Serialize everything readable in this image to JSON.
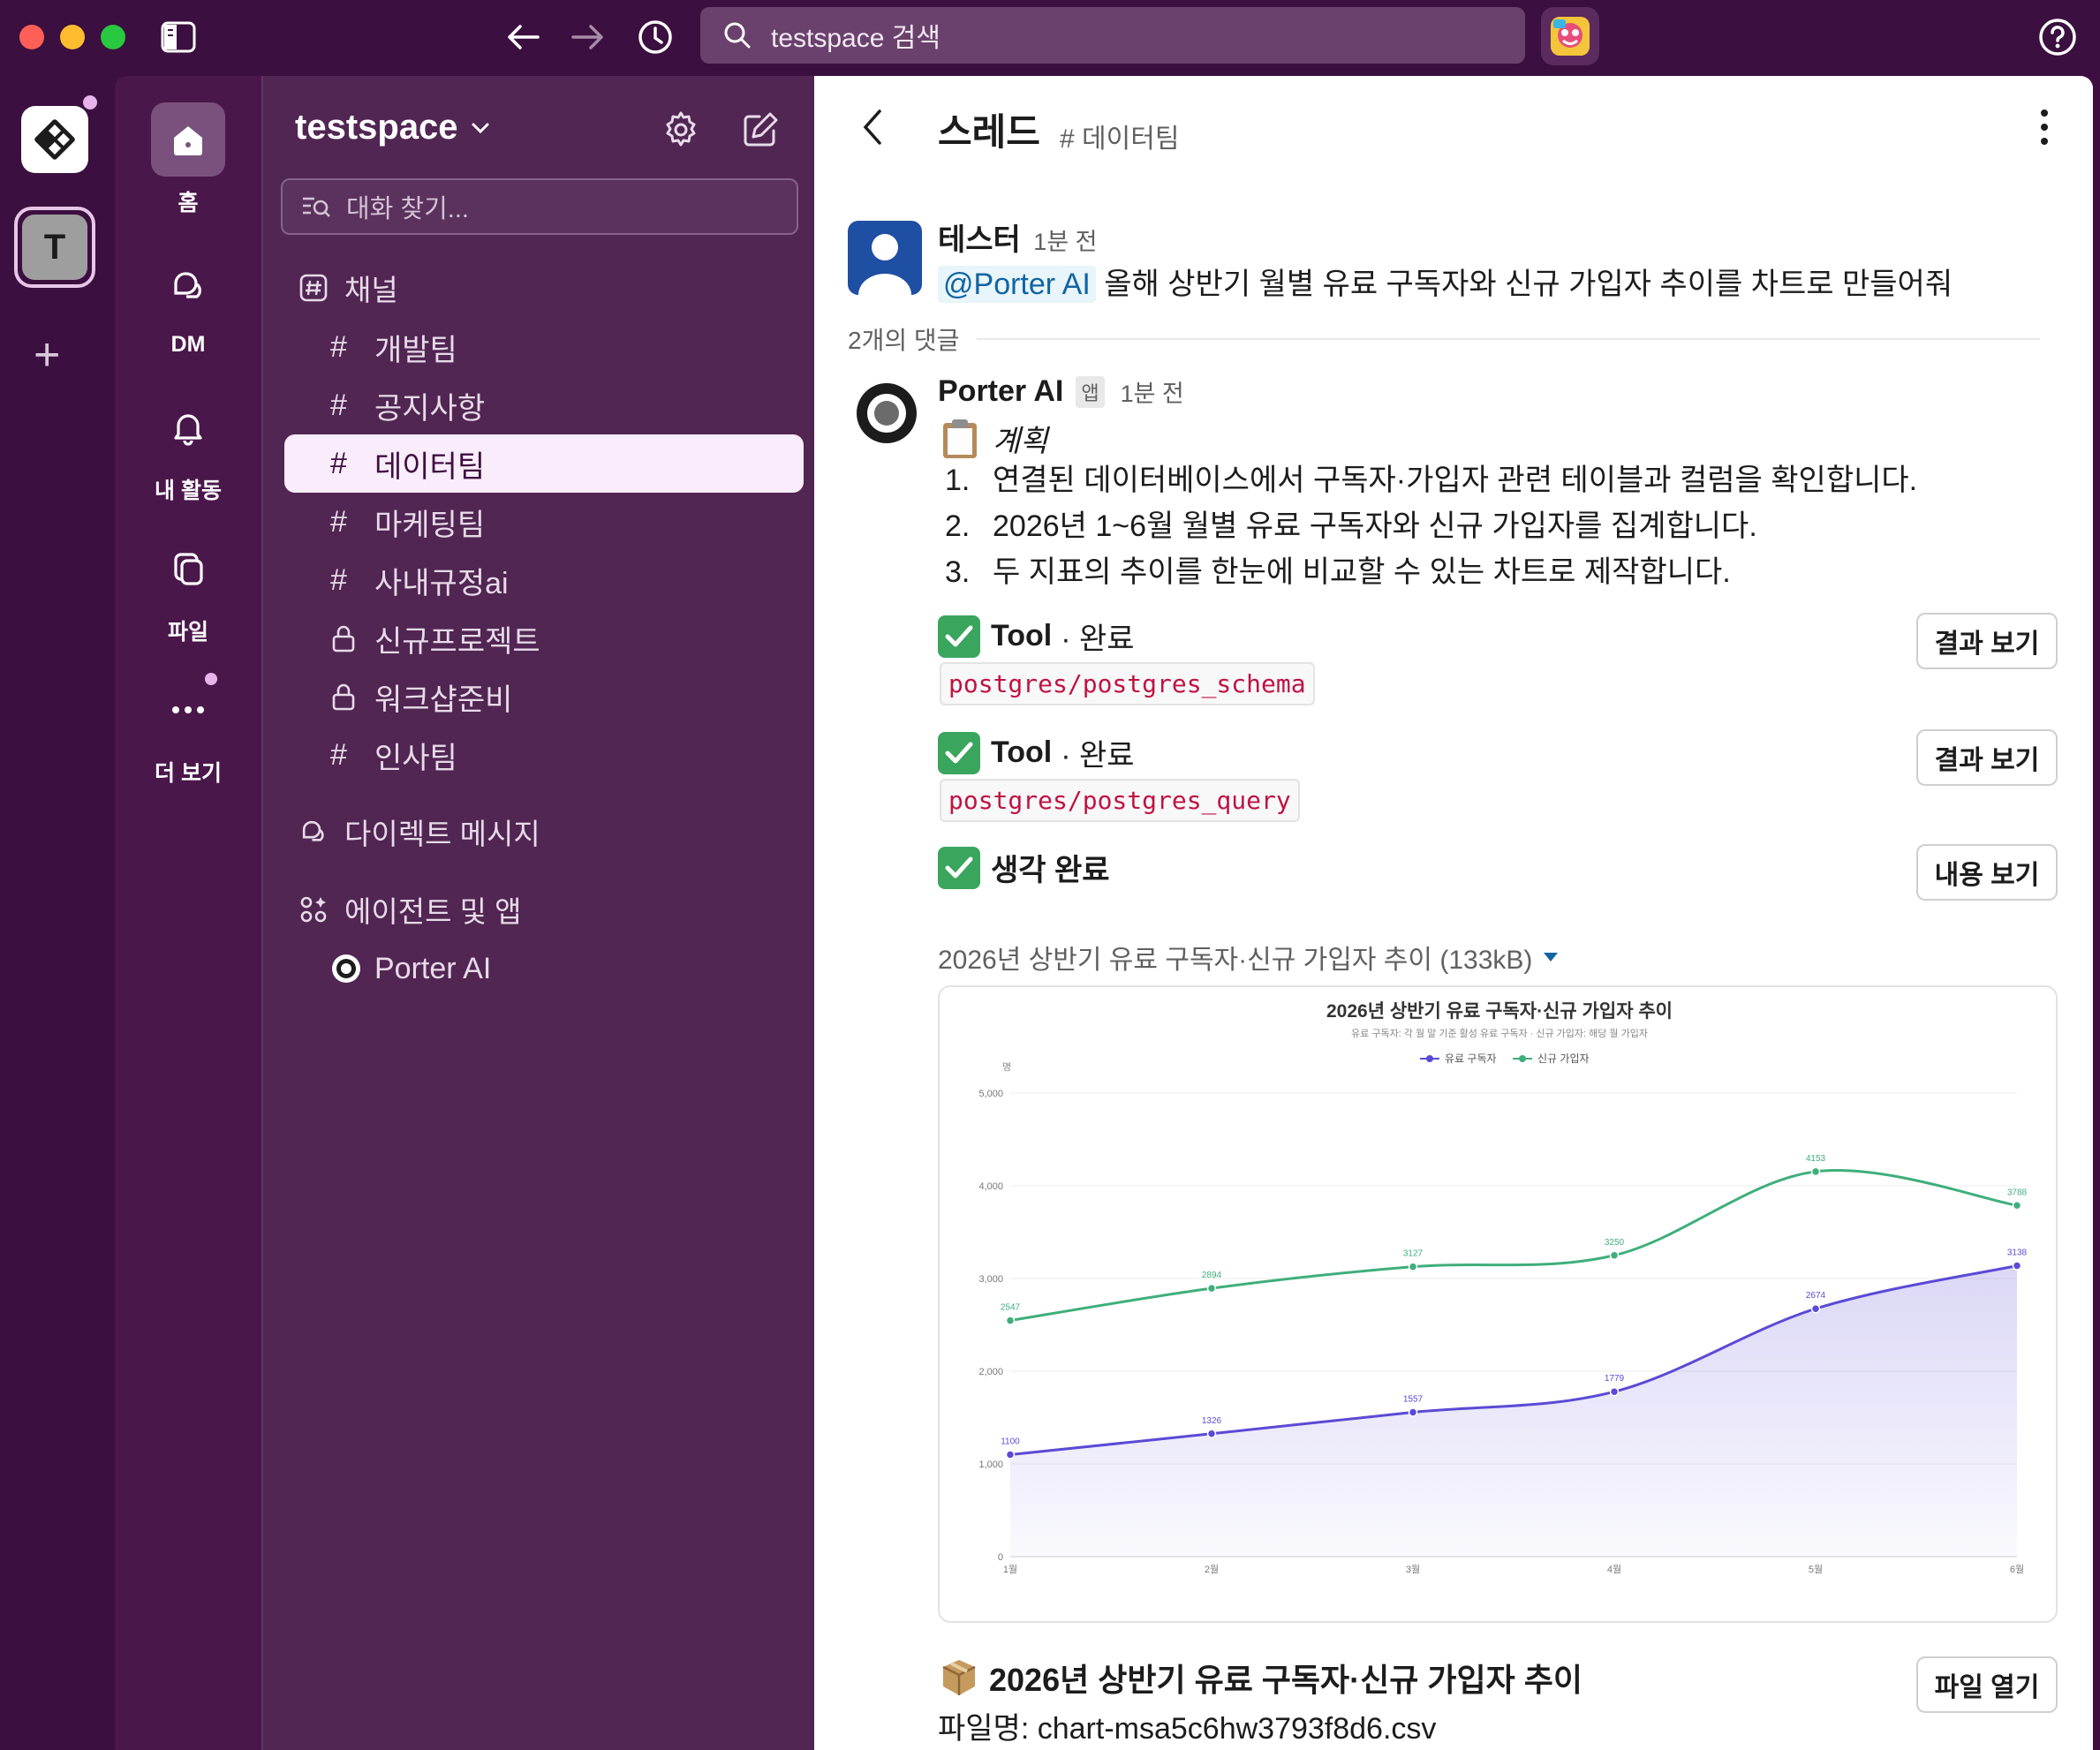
{
  "search": {
    "placeholder": "testspace 검색"
  },
  "rail": {
    "workspace_initial": "T"
  },
  "nav": {
    "home": "홈",
    "dm": "DM",
    "activity": "내 활동",
    "files": "파일",
    "more": "더 보기"
  },
  "sidebar": {
    "workspace": "testspace",
    "find_placeholder": "대화 찾기...",
    "channels_header": "채널",
    "channels": [
      {
        "name": "개발팀",
        "type": "public"
      },
      {
        "name": "공지사항",
        "type": "public"
      },
      {
        "name": "데이터팀",
        "type": "public",
        "active": true
      },
      {
        "name": "마케팅팀",
        "type": "public"
      },
      {
        "name": "사내규정ai",
        "type": "public"
      },
      {
        "name": "신규프로젝트",
        "type": "private"
      },
      {
        "name": "워크샵준비",
        "type": "private"
      },
      {
        "name": "인사팀",
        "type": "public"
      }
    ],
    "dm_header": "다이렉트 메시지",
    "apps_header": "에이전트 및 앱",
    "apps": [
      {
        "name": "Porter AI"
      }
    ]
  },
  "thread": {
    "title": "스레드",
    "channel": "# 데이터팀",
    "parent": {
      "author": "테스터",
      "time": "1분 전",
      "mention": "@Porter AI",
      "text": "올해 상반기 월별 유료 구독자와 신규 가입자 추이를 차트로 만들어줘"
    },
    "replies_label": "2개의 댓글",
    "reply": {
      "author": "Porter AI",
      "badge": "앱",
      "time": "1분 전",
      "plan_title": "계획",
      "plan_items": [
        {
          "num": "1.",
          "text": "연결된 데이터베이스에서 구독자·가입자 관련 테이블과 컬럼을 확인합니다."
        },
        {
          "num": "2.",
          "text": "2026년 1~6월 월별 유료 구독자와 신규 가입자를 집계합니다."
        },
        {
          "num": "3.",
          "text": "두 지표의 추이를 한눈에 비교할 수 있는 차트로 제작합니다."
        }
      ],
      "tools": [
        {
          "label": "Tool",
          "status": "· 완료",
          "code": "postgres/postgres_schema",
          "button": "결과 보기"
        },
        {
          "label": "Tool",
          "status": "· 완료",
          "code": "postgres/postgres_query",
          "button": "결과 보기"
        }
      ],
      "thinking": {
        "label": "생각 완료",
        "button": "내용 보기"
      },
      "file_label": "2026년 상반기 유료 구독자·신규 가입자 추이 (133kB)",
      "csv_title": "2026년 상반기 유료 구독자·신규 가입자 추이",
      "csv_filename": "파일명: chart-msa5c6hw3793f8d6.csv",
      "csv_button": "파일 열기"
    }
  },
  "chart_data": {
    "type": "line",
    "title": "2026년 상반기 유료 구독자·신규 가입자 추이",
    "subtitle": "유료 구독자: 각 월 말 기준 활성 유료 구독자 · 신규 가입자: 해당 월 가입자",
    "ylabel": "명",
    "categories": [
      "1월",
      "2월",
      "3월",
      "4월",
      "5월",
      "6월"
    ],
    "yticks": [
      "0",
      "1,000",
      "2,000",
      "3,000",
      "4,000",
      "5,000"
    ],
    "ylim": [
      0,
      5000
    ],
    "legend_position": "top",
    "grid": true,
    "series": [
      {
        "name": "유료 구독자",
        "color": "#5b4ad6",
        "values": [
          1100,
          1326,
          1557,
          1779,
          2674,
          3138
        ],
        "fill": true
      },
      {
        "name": "신규 가입자",
        "color": "#3fae7c",
        "values": [
          2547,
          2894,
          3127,
          3250,
          4153,
          3788
        ],
        "fill": false
      }
    ]
  },
  "colors": {
    "aubergine": "#3f0e40",
    "sidebar": "#512653",
    "active_channel": "#f9edfb",
    "mention": "#1264a3",
    "code": "#c01343",
    "check": "#3aa55d"
  }
}
